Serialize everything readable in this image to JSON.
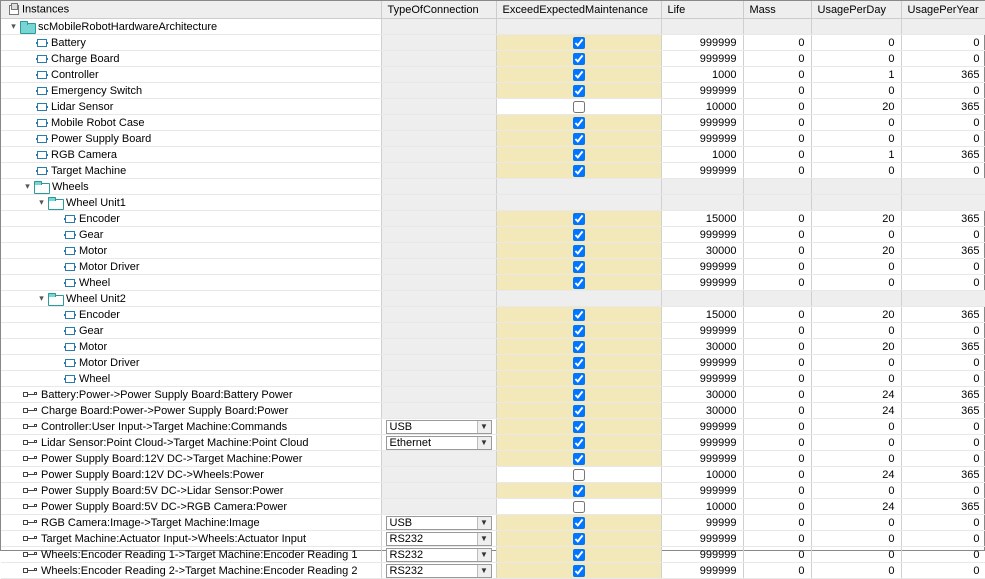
{
  "columns": {
    "instances": "Instances",
    "type": "TypeOfConnection",
    "exceed": "ExceedExpectedMaintenance",
    "life": "Life",
    "mass": "Mass",
    "usagePerDay": "UsagePerDay",
    "usagePerYear": "UsagePerYear"
  },
  "rows": [
    {
      "name": "scMobileRobotHardwareArchitecture",
      "indent": 0,
      "icon": "folder",
      "toggle": "▾",
      "typeGray": true,
      "exceedGray": true,
      "lifeGray": true,
      "massGray": true,
      "dayGray": true,
      "yearGray": true
    },
    {
      "name": "Battery",
      "indent": 2,
      "icon": "block",
      "typeGray": true,
      "checked": true,
      "life": "999999",
      "mass": "0",
      "day": "0",
      "year": "0"
    },
    {
      "name": "Charge Board",
      "indent": 2,
      "icon": "block",
      "typeGray": true,
      "checked": true,
      "life": "999999",
      "mass": "0",
      "day": "0",
      "year": "0"
    },
    {
      "name": "Controller",
      "indent": 2,
      "icon": "block",
      "typeGray": true,
      "checked": true,
      "life": "1000",
      "mass": "0",
      "day": "1",
      "year": "365"
    },
    {
      "name": "Emergency Switch",
      "indent": 2,
      "icon": "block",
      "typeGray": true,
      "checked": true,
      "life": "999999",
      "mass": "0",
      "day": "0",
      "year": "0"
    },
    {
      "name": "Lidar Sensor",
      "indent": 2,
      "icon": "block",
      "typeGray": true,
      "checked": false,
      "noHighlight": true,
      "life": "10000",
      "mass": "0",
      "day": "20",
      "year": "365"
    },
    {
      "name": "Mobile Robot Case",
      "indent": 2,
      "icon": "block",
      "typeGray": true,
      "checked": true,
      "life": "999999",
      "mass": "0",
      "day": "0",
      "year": "0"
    },
    {
      "name": "Power Supply Board",
      "indent": 2,
      "icon": "block",
      "typeGray": true,
      "checked": true,
      "life": "999999",
      "mass": "0",
      "day": "0",
      "year": "0"
    },
    {
      "name": "RGB Camera",
      "indent": 2,
      "icon": "block",
      "typeGray": true,
      "checked": true,
      "life": "1000",
      "mass": "0",
      "day": "1",
      "year": "365"
    },
    {
      "name": "Target Machine",
      "indent": 2,
      "icon": "block",
      "typeGray": true,
      "checked": true,
      "life": "999999",
      "mass": "0",
      "day": "0",
      "year": "0"
    },
    {
      "name": "Wheels",
      "indent": 1,
      "icon": "folder-open",
      "toggle": "▾",
      "typeGray": true,
      "exceedGray": true,
      "lifeGray": true,
      "massGray": true,
      "dayGray": true,
      "yearGray": true
    },
    {
      "name": "Wheel Unit1",
      "indent": 2,
      "icon": "folder-open",
      "toggle": "▾",
      "typeGray": true,
      "exceedGray": true,
      "lifeGray": true,
      "massGray": true,
      "dayGray": true,
      "yearGray": true
    },
    {
      "name": "Encoder",
      "indent": 4,
      "icon": "block",
      "typeGray": true,
      "checked": true,
      "life": "15000",
      "mass": "0",
      "day": "20",
      "year": "365"
    },
    {
      "name": "Gear",
      "indent": 4,
      "icon": "block",
      "typeGray": true,
      "checked": true,
      "life": "999999",
      "mass": "0",
      "day": "0",
      "year": "0"
    },
    {
      "name": "Motor",
      "indent": 4,
      "icon": "block",
      "typeGray": true,
      "checked": true,
      "life": "30000",
      "mass": "0",
      "day": "20",
      "year": "365"
    },
    {
      "name": "Motor Driver",
      "indent": 4,
      "icon": "block",
      "typeGray": true,
      "checked": true,
      "life": "999999",
      "mass": "0",
      "day": "0",
      "year": "0"
    },
    {
      "name": "Wheel",
      "indent": 4,
      "icon": "block",
      "typeGray": true,
      "checked": true,
      "life": "999999",
      "mass": "0",
      "day": "0",
      "year": "0"
    },
    {
      "name": "Wheel Unit2",
      "indent": 2,
      "icon": "folder-open",
      "toggle": "▾",
      "typeGray": true,
      "exceedGray": true,
      "lifeGray": true,
      "massGray": true,
      "dayGray": true,
      "yearGray": true
    },
    {
      "name": "Encoder",
      "indent": 4,
      "icon": "block",
      "typeGray": true,
      "checked": true,
      "life": "15000",
      "mass": "0",
      "day": "20",
      "year": "365"
    },
    {
      "name": "Gear",
      "indent": 4,
      "icon": "block",
      "typeGray": true,
      "checked": true,
      "life": "999999",
      "mass": "0",
      "day": "0",
      "year": "0"
    },
    {
      "name": "Motor",
      "indent": 4,
      "icon": "block",
      "typeGray": true,
      "checked": true,
      "life": "30000",
      "mass": "0",
      "day": "20",
      "year": "365"
    },
    {
      "name": "Motor Driver",
      "indent": 4,
      "icon": "block",
      "typeGray": true,
      "checked": true,
      "life": "999999",
      "mass": "0",
      "day": "0",
      "year": "0"
    },
    {
      "name": "Wheel",
      "indent": 4,
      "icon": "block",
      "typeGray": true,
      "checked": true,
      "life": "999999",
      "mass": "0",
      "day": "0",
      "year": "0"
    },
    {
      "name": "Battery:Power->Power Supply Board:Battery Power",
      "indent": 1,
      "icon": "conn",
      "typeGray": true,
      "checked": true,
      "life": "30000",
      "mass": "0",
      "day": "24",
      "year": "365"
    },
    {
      "name": "Charge Board:Power->Power Supply Board:Power",
      "indent": 1,
      "icon": "conn",
      "typeGray": true,
      "checked": true,
      "life": "30000",
      "mass": "0",
      "day": "24",
      "year": "365"
    },
    {
      "name": "Controller:User Input->Target Machine:Commands",
      "indent": 1,
      "icon": "conn",
      "typeDD": "USB",
      "checked": true,
      "life": "999999",
      "mass": "0",
      "day": "0",
      "year": "0"
    },
    {
      "name": "Lidar Sensor:Point Cloud->Target Machine:Point Cloud",
      "indent": 1,
      "icon": "conn",
      "typeDD": "Ethernet",
      "checked": true,
      "life": "999999",
      "mass": "0",
      "day": "0",
      "year": "0"
    },
    {
      "name": "Power Supply Board:12V DC->Target Machine:Power",
      "indent": 1,
      "icon": "conn",
      "typeGray": true,
      "checked": true,
      "life": "999999",
      "mass": "0",
      "day": "0",
      "year": "0"
    },
    {
      "name": "Power Supply Board:12V DC->Wheels:Power",
      "indent": 1,
      "icon": "conn",
      "typeGray": true,
      "checked": false,
      "noHighlight": true,
      "life": "10000",
      "mass": "0",
      "day": "24",
      "year": "365"
    },
    {
      "name": "Power Supply Board:5V DC->Lidar Sensor:Power",
      "indent": 1,
      "icon": "conn",
      "typeGray": true,
      "checked": true,
      "life": "999999",
      "mass": "0",
      "day": "0",
      "year": "0"
    },
    {
      "name": "Power Supply Board:5V DC->RGB Camera:Power",
      "indent": 1,
      "icon": "conn",
      "typeGray": true,
      "checked": false,
      "noHighlight": true,
      "life": "10000",
      "mass": "0",
      "day": "24",
      "year": "365"
    },
    {
      "name": "RGB Camera:Image->Target Machine:Image",
      "indent": 1,
      "icon": "conn",
      "typeDD": "USB",
      "checked": true,
      "life": "99999",
      "mass": "0",
      "day": "0",
      "year": "0"
    },
    {
      "name": "Target Machine:Actuator Input->Wheels:Actuator Input",
      "indent": 1,
      "icon": "conn",
      "typeDD": "RS232",
      "checked": true,
      "life": "999999",
      "mass": "0",
      "day": "0",
      "year": "0"
    },
    {
      "name": "Wheels:Encoder Reading 1->Target Machine:Encoder Reading 1",
      "indent": 1,
      "icon": "conn",
      "typeDD": "RS232",
      "checked": true,
      "life": "999999",
      "mass": "0",
      "day": "0",
      "year": "0"
    },
    {
      "name": "Wheels:Encoder Reading 2->Target Machine:Encoder Reading 2",
      "indent": 1,
      "icon": "conn",
      "typeDD": "RS232",
      "checked": true,
      "life": "999999",
      "mass": "0",
      "day": "0",
      "year": "0"
    }
  ]
}
